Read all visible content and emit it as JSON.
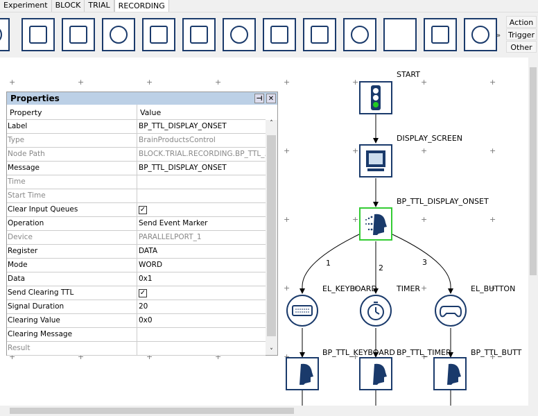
{
  "tabs": [
    {
      "label": "Experiment"
    },
    {
      "label": "BLOCK"
    },
    {
      "label": "TRIAL"
    },
    {
      "label": "RECORDING",
      "active": true
    }
  ],
  "toolbar": {
    "scroll_left": "«",
    "scroll_right": "»",
    "buttons": [
      {
        "icon": "partial-icon"
      },
      {
        "icon": "speaker-icon"
      },
      {
        "icon": "speaker-play-icon"
      },
      {
        "icon": "microphone-record-icon"
      },
      {
        "icon": "microphone-play-icon"
      },
      {
        "icon": "add-list-icon"
      },
      {
        "icon": "ttl-icon"
      },
      {
        "icon": "loop-icon"
      },
      {
        "icon": "stop-sign-icon"
      },
      {
        "icon": "recycle-icon"
      },
      {
        "icon": "blank-icon"
      },
      {
        "icon": "brain-icon"
      },
      {
        "icon": "brainproducts-head-icon"
      }
    ],
    "categories": [
      "Action",
      "Trigger",
      "Other"
    ]
  },
  "properties": {
    "title": "Properties",
    "pin": "⊣",
    "close": "✕",
    "header": {
      "property": "Property",
      "value": "Value"
    },
    "rows": [
      {
        "name": "Label",
        "value": "BP_TTL_DISPLAY_ONSET"
      },
      {
        "name": "Type",
        "value": "BrainProductsControl",
        "readonly": true
      },
      {
        "name": "Node Path",
        "value": "BLOCK.TRIAL.RECORDING.BP_TTL_...",
        "readonly": true
      },
      {
        "name": "Message",
        "value": "BP_TTL_DISPLAY_ONSET"
      },
      {
        "name": "Time",
        "value": "",
        "readonly": true
      },
      {
        "name": "Start Time",
        "value": "",
        "readonly": true
      },
      {
        "name": "Clear Input Queues",
        "value": "",
        "checked": true
      },
      {
        "name": "Operation",
        "value": "Send Event Marker"
      },
      {
        "name": "Device",
        "value": "PARALLELPORT_1",
        "readonly": true
      },
      {
        "name": "Register",
        "value": "DATA"
      },
      {
        "name": "Mode",
        "value": "WORD"
      },
      {
        "name": "Data",
        "value": "0x1"
      },
      {
        "name": "Send Clearing TTL",
        "value": "",
        "checked": true
      },
      {
        "name": "Signal Duration",
        "value": "20"
      },
      {
        "name": "Clearing Value",
        "value": "0x0"
      },
      {
        "name": "Clearing Message",
        "value": ""
      },
      {
        "name": "Result",
        "value": "",
        "readonly": true
      }
    ]
  },
  "diagram": {
    "nodes": {
      "start": "START",
      "display": "DISPLAY_SCREEN",
      "onset": "BP_TTL_DISPLAY_ONSET",
      "keyboard": "EL_KEYBOARD",
      "timer": "TIMER",
      "button": "EL_BUTTON",
      "bp_keyboard": "BP_TTL_KEYBOARD",
      "bp_timer": "BP_TTL_TIMER",
      "bp_button": "BP_TTL_BUTT"
    },
    "edges": [
      "1",
      "2",
      "3"
    ],
    "selected_color": "#33cc33"
  }
}
